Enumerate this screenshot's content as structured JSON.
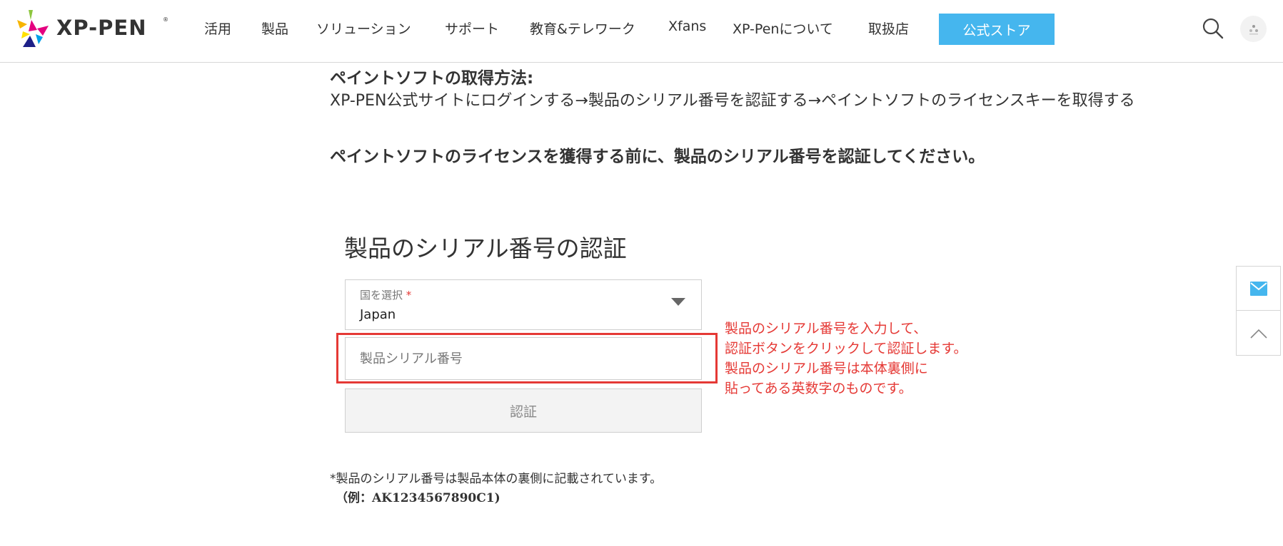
{
  "header": {
    "logo_text": "XP-PEN",
    "logo_mark": "®",
    "nav": [
      {
        "label": "活用"
      },
      {
        "label": "製品"
      },
      {
        "label": "ソリューション"
      },
      {
        "label": "サポート"
      },
      {
        "label": "教育&テレワーク"
      },
      {
        "label": "Xfans"
      },
      {
        "label": "XP-Penについて"
      },
      {
        "label": "取扱店"
      }
    ],
    "store_button": "公式ストア",
    "icons": [
      "search-icon",
      "avatar"
    ]
  },
  "content": {
    "heading_get": "ペイントソフトの取得方法:",
    "steps": "XP-PEN公式サイトにログインする→製品のシリアル番号を認証する→ペイントソフトのライセンスキーを取得する",
    "heading_note": "ペイントソフトのライセンスを獲得する前に、製品のシリアル番号を認証してください。"
  },
  "form": {
    "title": "製品のシリアル番号の認証",
    "country_label": "国を選択",
    "country_required": "*",
    "country_value": "Japan",
    "serial_placeholder": "製品シリアル番号",
    "verify_button": "認証",
    "note": "*製品のシリアル番号は製品本体の裏側に記載されています。",
    "example": "（例：AK1234567890C1)"
  },
  "annotation": {
    "lines": [
      "製品のシリアル番号を入力して、",
      "認証ボタンをクリックして認証します。",
      "製品のシリアル番号は本体裏側に",
      "貼ってある英数字のものです。"
    ],
    "color": "#e53935"
  },
  "side": {
    "icons": [
      "mail-icon",
      "chevron-up-icon"
    ]
  },
  "colors": {
    "accent": "#45b6ee",
    "highlight": "#e53935"
  }
}
